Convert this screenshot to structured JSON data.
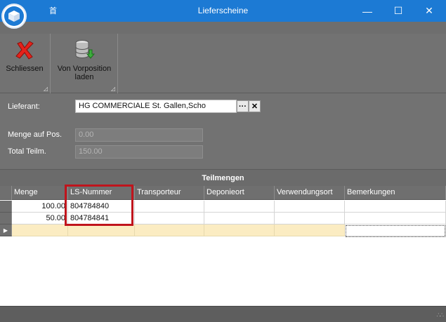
{
  "window": {
    "title": "Lieferscheine",
    "qat_glyph": "⾸",
    "minimize": "—",
    "maximize": "☐",
    "close": "✕"
  },
  "ribbon": {
    "close_label": "Schliessen",
    "load_label_line1": "Von Vorposition",
    "load_label_line2": "laden",
    "corner_glyph": "◿"
  },
  "form": {
    "lieferant_label": "Lieferant:",
    "lieferant_value": "HG COMMERCIALE St. Gallen,Scho",
    "browse_label": "···",
    "clear_label": "✕",
    "menge_label": "Menge auf Pos.",
    "menge_value": "0.00",
    "total_label": "Total Teilm.",
    "total_value": "150.00"
  },
  "grid": {
    "caption": "Teilmengen",
    "columns": [
      "Menge",
      "LS-Nummer",
      "Transporteur",
      "Deponieort",
      "Verwendungsort",
      "Bemerkungen"
    ],
    "rows": [
      {
        "menge": "100.00",
        "ls": "804784840",
        "transporteur": "",
        "deponieort": "",
        "verwendungsort": "",
        "bemerkungen": ""
      },
      {
        "menge": "50.00",
        "ls": "804784841",
        "transporteur": "",
        "deponieort": "",
        "verwendungsort": "",
        "bemerkungen": ""
      }
    ],
    "new_row_indicator": "▶"
  },
  "status": {
    "grip": "∴∴"
  },
  "colors": {
    "titlebar": "#1c7ad4",
    "ribbon": "#727272",
    "new_row": "#fbecc2",
    "highlight": "#c0141c"
  }
}
